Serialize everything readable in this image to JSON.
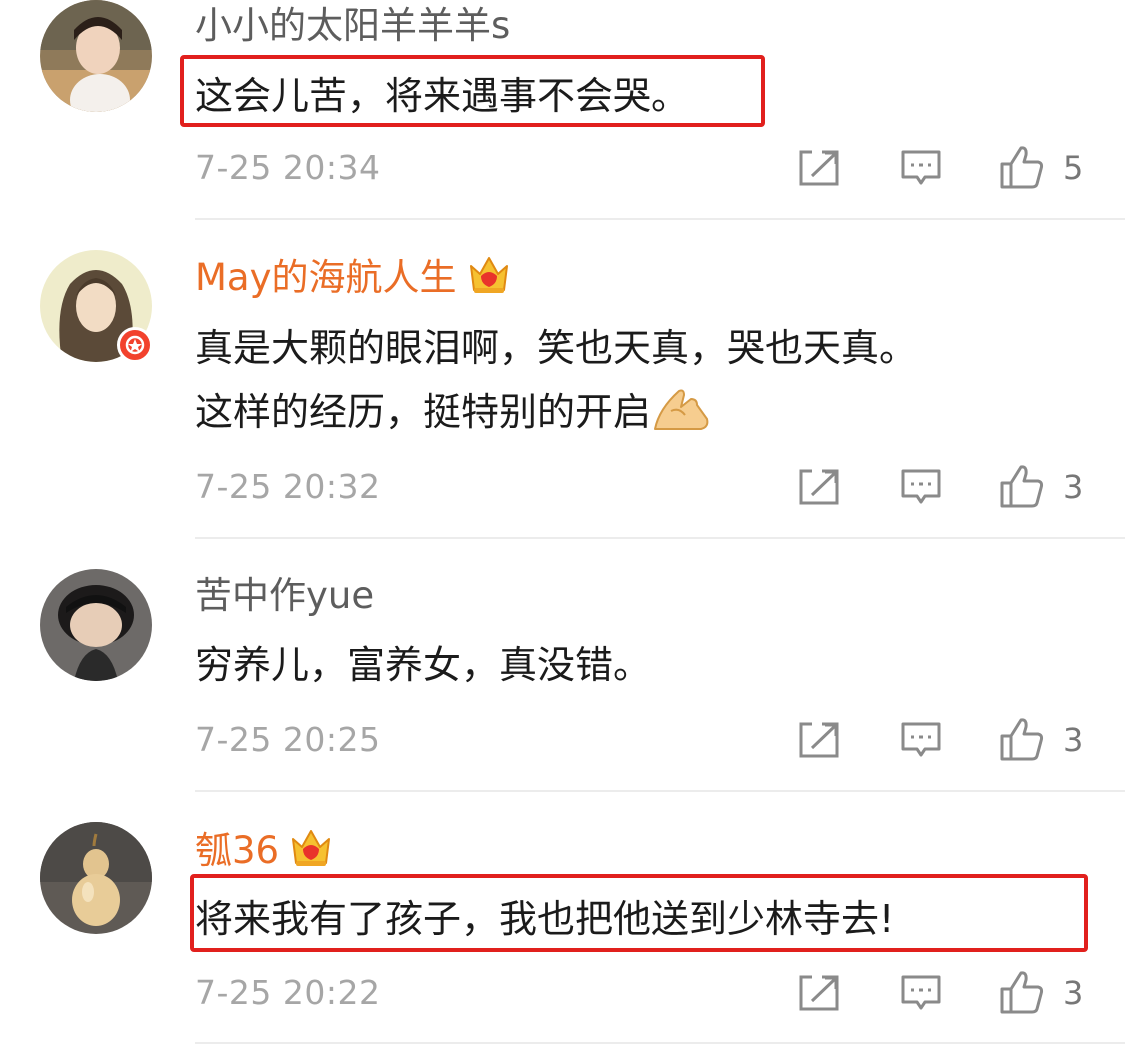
{
  "comments": [
    {
      "username": "小小的太阳羊羊羊s",
      "username_color": "#5d5d5d",
      "vip": false,
      "lines": [
        "这会儿苦，将来遇事不会哭。"
      ],
      "timestamp": "7-25 20:34",
      "likes": "5",
      "highlighted": true
    },
    {
      "username": "May的海航人生",
      "username_color": "#ea6d26",
      "vip": true,
      "verified_badge": true,
      "lines": [
        "真是大颗的眼泪啊，笑也天真，哭也天真。",
        "这样的经历，挺特别的开启"
      ],
      "emoji": "pray-hands-emoji",
      "timestamp": "7-25 20:32",
      "likes": "3",
      "highlighted": false
    },
    {
      "username": "苦中作yue",
      "username_color": "#5d5d5d",
      "vip": false,
      "lines": [
        "穷养儿，富养女，真没错。"
      ],
      "timestamp": "7-25 20:25",
      "likes": "3",
      "highlighted": false
    },
    {
      "username": "瓠36",
      "username_color": "#ea6d26",
      "vip": true,
      "lines": [
        "将来我有了孩子，我也把他送到少林寺去!"
      ],
      "timestamp": "7-25 20:22",
      "likes": "3",
      "highlighted": true
    }
  ],
  "colors": {
    "highlight_border": "#e1201d",
    "vip_name": "#ea6d26",
    "timestamp": "#a6a6a6",
    "icon": "#8a8a8a"
  },
  "icons": [
    "share-icon",
    "reply-comment-icon",
    "thumbs-up-icon",
    "crown-vip-icon",
    "verified-badge-icon"
  ]
}
